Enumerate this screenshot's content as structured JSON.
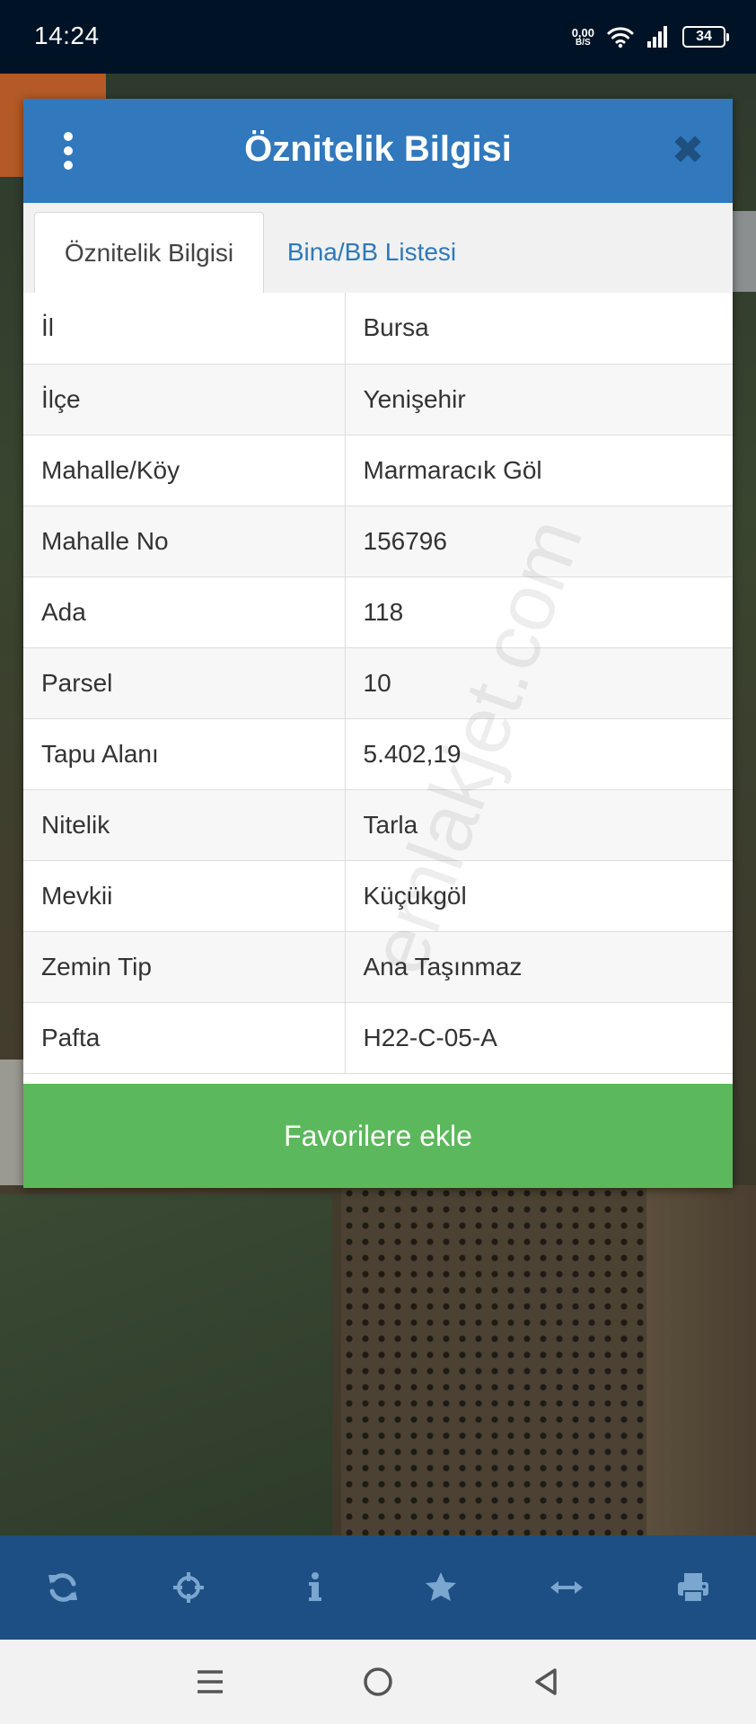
{
  "status_bar": {
    "time": "14:24",
    "net_speed_value": "0,00",
    "net_speed_unit": "B/S",
    "battery": "34",
    "icons": [
      "wifi-icon",
      "signal-icon",
      "battery-icon"
    ]
  },
  "dialog": {
    "title": "Öznitelik Bilgisi",
    "menu_icon": "kebab-menu-icon",
    "close_icon": "close-icon",
    "tabs": [
      {
        "label": "Öznitelik Bilgisi",
        "active": true
      },
      {
        "label": "Bina/BB Listesi",
        "active": false
      }
    ],
    "rows": [
      {
        "key": "İl",
        "value": "Bursa"
      },
      {
        "key": "İlçe",
        "value": "Yenişehir"
      },
      {
        "key": "Mahalle/Köy",
        "value": "Marmaracık Göl"
      },
      {
        "key": "Mahalle No",
        "value": "156796"
      },
      {
        "key": "Ada",
        "value": "118"
      },
      {
        "key": "Parsel",
        "value": "10"
      },
      {
        "key": "Tapu Alanı",
        "value": "5.402,19"
      },
      {
        "key": "Nitelik",
        "value": "Tarla"
      },
      {
        "key": "Mevkii",
        "value": "Küçükgöl"
      },
      {
        "key": "Zemin Tip",
        "value": "Ana Taşınmaz"
      },
      {
        "key": "Pafta",
        "value": "H22-C-05-A"
      }
    ],
    "favorite_button": "Favorilere ekle"
  },
  "watermark": "emlakjet.com",
  "toolbar": {
    "items": [
      "refresh-icon",
      "crosshair-icon",
      "info-icon",
      "star-icon",
      "measure-icon",
      "print-icon"
    ]
  },
  "navbar": {
    "items": [
      "recent-apps-icon",
      "home-icon",
      "back-icon"
    ]
  },
  "colors": {
    "header_blue": "#3178bd",
    "toolbar_blue": "#1d4f84",
    "favorite_green": "#5cb85c",
    "status_bar_bg": "#001326",
    "tab_link_blue": "#2f79b9"
  }
}
